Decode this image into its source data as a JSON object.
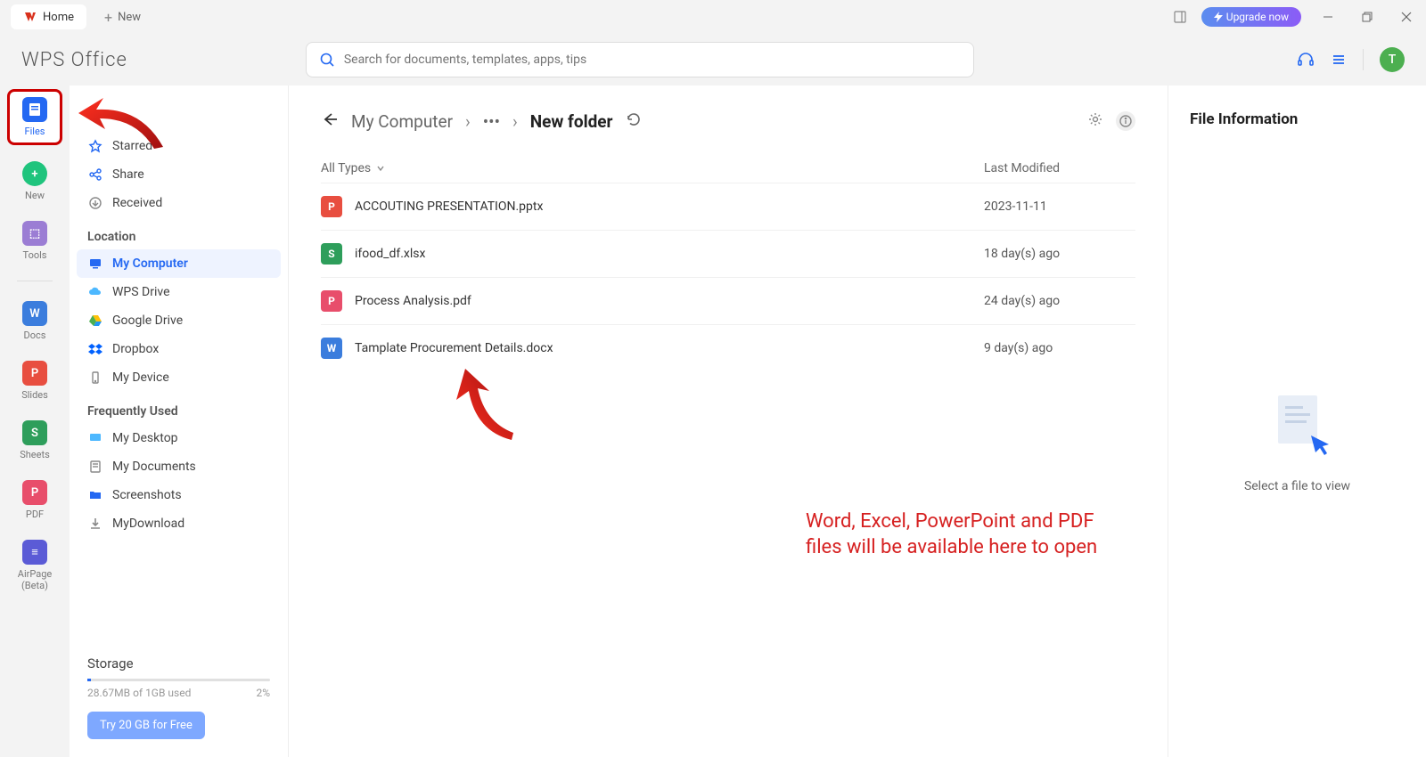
{
  "titlebar": {
    "home_tab": "Home",
    "new_tab": "New",
    "upgrade": "Upgrade now"
  },
  "logo": "WPS Office",
  "search": {
    "placeholder": "Search for documents, templates, apps, tips"
  },
  "avatar_letter": "T",
  "rail": {
    "files": "Files",
    "new": "New",
    "tools": "Tools",
    "docs": "Docs",
    "slides": "Slides",
    "sheets": "Sheets",
    "pdf": "PDF",
    "airpage": "AirPage\n(Beta)"
  },
  "sidebar": {
    "starred": "Starred",
    "share": "Share",
    "received": "Received",
    "location_header": "Location",
    "my_computer": "My Computer",
    "wps_drive": "WPS Drive",
    "google_drive": "Google Drive",
    "dropbox": "Dropbox",
    "my_device": "My Device",
    "freq_header": "Frequently Used",
    "my_desktop": "My Desktop",
    "my_documents": "My Documents",
    "screenshots": "Screenshots",
    "my_download": "MyDownload"
  },
  "storage": {
    "title": "Storage",
    "used": "28.67MB of 1GB used",
    "pct": "2%",
    "btn": "Try 20 GB for Free"
  },
  "breadcrumb": {
    "seg1": "My Computer",
    "current": "New folder"
  },
  "list": {
    "filter": "All Types",
    "col_date": "Last Modified"
  },
  "files": [
    {
      "name": "ACCOUTING PRESENTATION.pptx",
      "date": "2023-11-11",
      "color": "#e84e40",
      "letter": "P"
    },
    {
      "name": "ifood_df.xlsx",
      "date": "18 day(s) ago",
      "color": "#2e9e5b",
      "letter": "S"
    },
    {
      "name": "Process Analysis.pdf",
      "date": "24 day(s) ago",
      "color": "#e84e6b",
      "letter": "P"
    },
    {
      "name": "Tamplate Procurement Details.docx",
      "date": "9 day(s) ago",
      "color": "#3b7ddd",
      "letter": "W"
    }
  ],
  "info": {
    "title": "File Information",
    "empty": "Select a file to view"
  },
  "annotation": "Word, Excel, PowerPoint and PDF\nfiles will be available here to open"
}
